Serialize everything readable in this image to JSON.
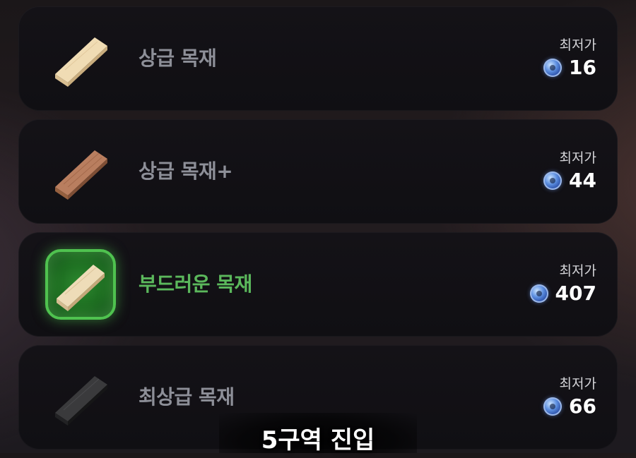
{
  "items": [
    {
      "name": "상급 목재",
      "price_label": "최저가",
      "price": "16",
      "icon": "light-wood-plank-icon",
      "selected": false
    },
    {
      "name": "상급 목재+",
      "price_label": "최저가",
      "price": "44",
      "icon": "brown-wood-plank-icon",
      "selected": false
    },
    {
      "name": "부드러운 목재",
      "price_label": "최저가",
      "price": "407",
      "icon": "soft-wood-plank-icon",
      "selected": true
    },
    {
      "name": "최상급 목재",
      "price_label": "최저가",
      "price": "66",
      "icon": "black-wood-plank-icon",
      "selected": false
    }
  ],
  "banner": {
    "text": "5구역 진입"
  },
  "colors": {
    "selected_name": "#5bb85c",
    "selected_glow": "#4fc24f",
    "name": "#8d8f98"
  }
}
